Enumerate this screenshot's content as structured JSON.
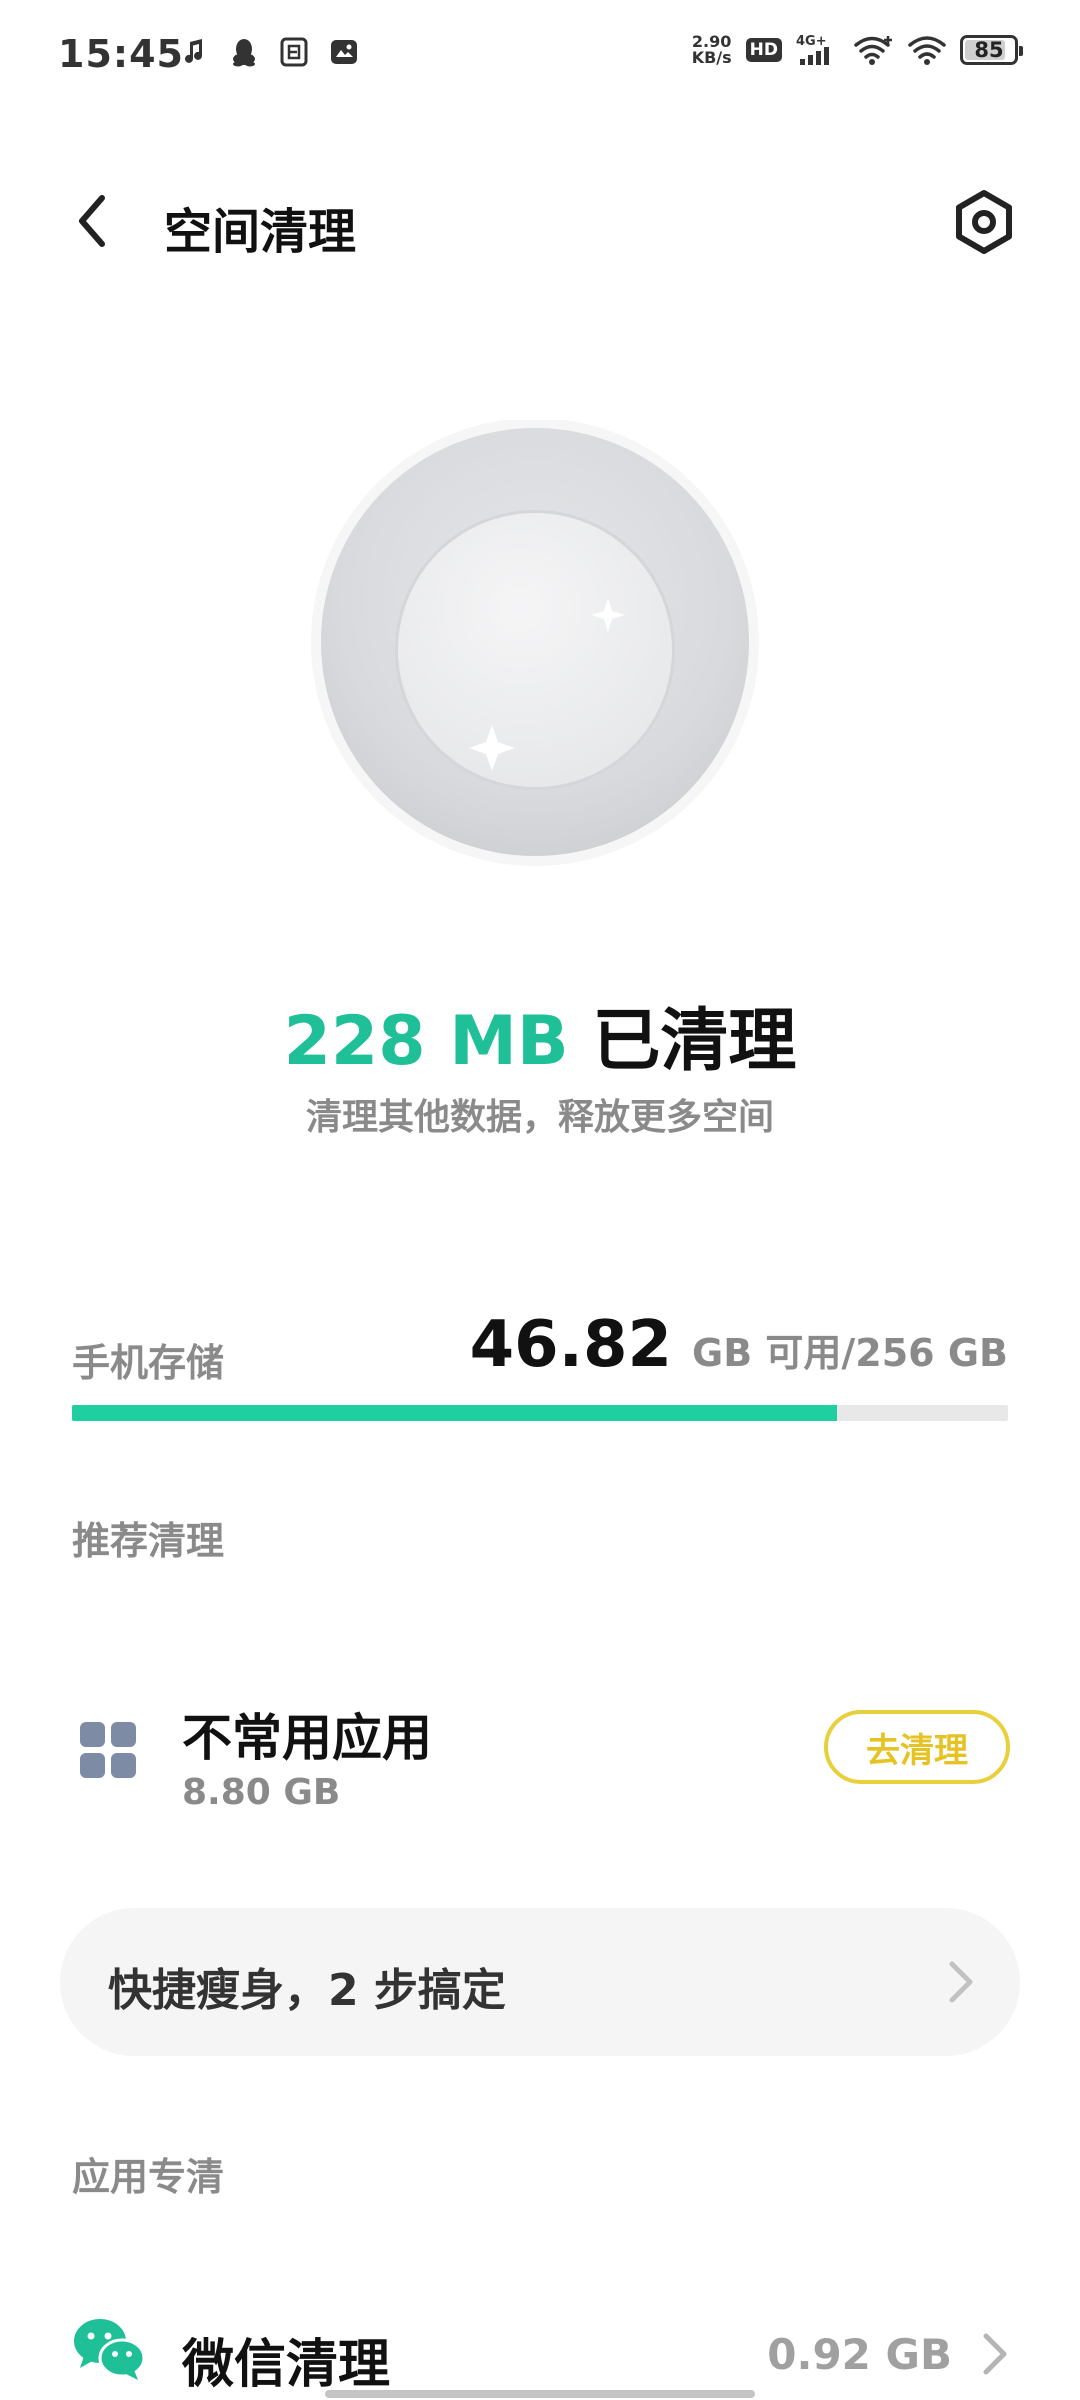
{
  "status_bar": {
    "time": "15:45",
    "net_speed_value": "2.90",
    "net_speed_unit": "KB/s",
    "hd_badge": "HD",
    "network": "4G+",
    "battery": "85",
    "battery_level": 0.85
  },
  "header": {
    "title": "空间清理"
  },
  "summary": {
    "cleaned_amount": "228 MB",
    "cleaned_label": "已清理",
    "subtitle": "清理其他数据，释放更多空间"
  },
  "storage": {
    "label": "手机存储",
    "free_value": "46.82",
    "total_text": "GB 可用/256 GB",
    "used_fraction": 0.817
  },
  "recommended": {
    "heading": "推荐清理",
    "item": {
      "name": "不常用应用",
      "size": "8.80 GB",
      "button_label": "去清理"
    }
  },
  "quick_slim": {
    "text": "快捷瘦身，2 步搞定"
  },
  "app_clean": {
    "heading": "应用专清",
    "wechat": {
      "label": "微信清理",
      "size": "0.92 GB"
    }
  },
  "colors": {
    "accent_green": "#1fbf97",
    "bar_green": "#1fcf9f",
    "button_yellow": "#e6c323",
    "muted_text": "#8a8a8a"
  },
  "icons": {
    "back": "chevron-left-icon",
    "settings": "hexagon-settings-icon",
    "apps": "grid-apps-icon",
    "wechat": "wechat-icon",
    "chevron": "chevron-right-icon"
  }
}
